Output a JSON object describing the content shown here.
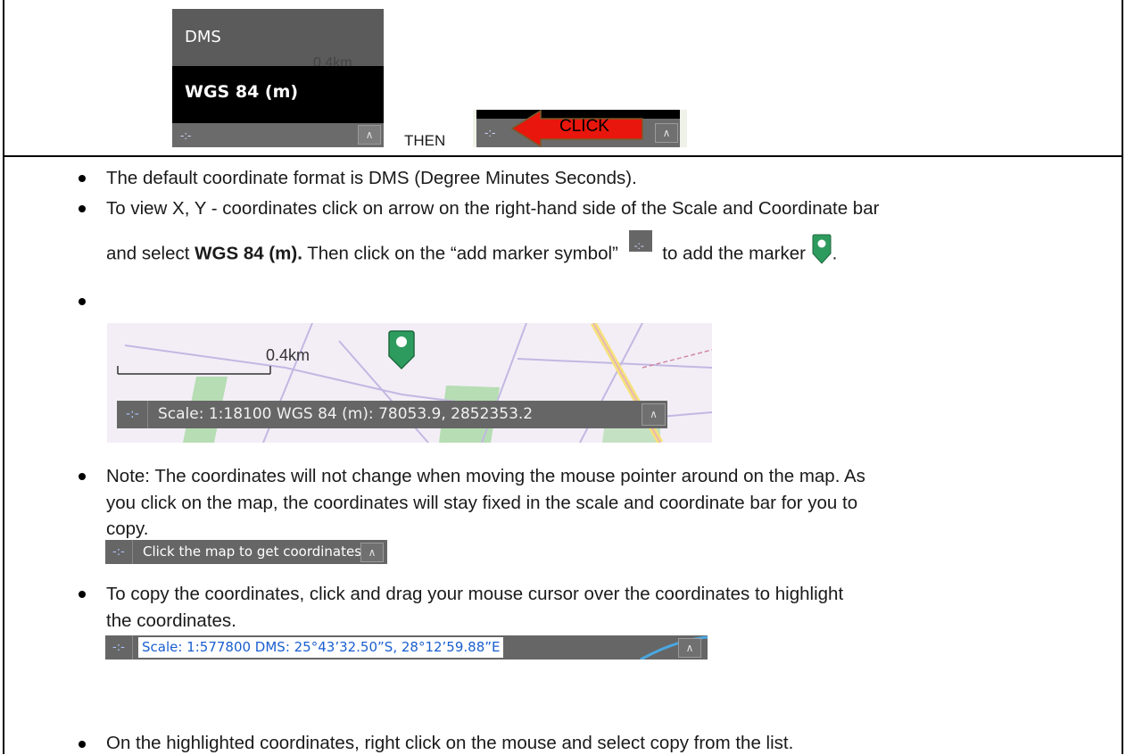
{
  "top": {
    "menu_dms": "DMS",
    "menu_wgs": "WGS 84 (m)",
    "map_scale_fragment": "0.4km",
    "then_label": "THEN",
    "click_label": "CLICK"
  },
  "bullets": {
    "b1": "The default coordinate format is DMS (Degree Minutes Seconds).",
    "b2_line1": "To view X, Y - coordinates click on arrow on the right-hand side of the Scale and Coordinate bar",
    "b2_line2_pre": "and select ",
    "b2_line2_bold": "WGS 84 (m).",
    "b2_line2_mid": " Then click on the “add marker symbol” ",
    "b2_line2_post": " to add the marker",
    "b2_line2_end": ".",
    "b4_line1": "Note: The coordinates will not change when moving the mouse pointer around on the map. As",
    "b4_line2": "you click on the map, the coordinates will stay fixed in the scale and coordinate bar for you to",
    "b4_line3": "copy.",
    "b5_line1": "To copy the coordinates, click and drag your mouse cursor over the coordinates to highlight",
    "b5_line2": "the coordinates.",
    "b6": "On the highlighted coordinates, right click on the mouse and select copy from the list."
  },
  "map": {
    "scale_label": "0.4km",
    "bar_text": "Scale: 1:18100 WGS 84 (m): 78053.9, 2852353.2"
  },
  "bars": {
    "click_prompt": "Click the map to get coordinates",
    "highlighted": "Scale: 1:577800 DMS: 25°43’32.50”S, 28°12’59.88”E"
  },
  "icons": {
    "crosshair": "crosshair-icon",
    "chevron": "chevron-up-icon",
    "marker": "map-marker-icon",
    "marker_color": "#2e9b5e",
    "arrow_color": "#e8160c"
  }
}
